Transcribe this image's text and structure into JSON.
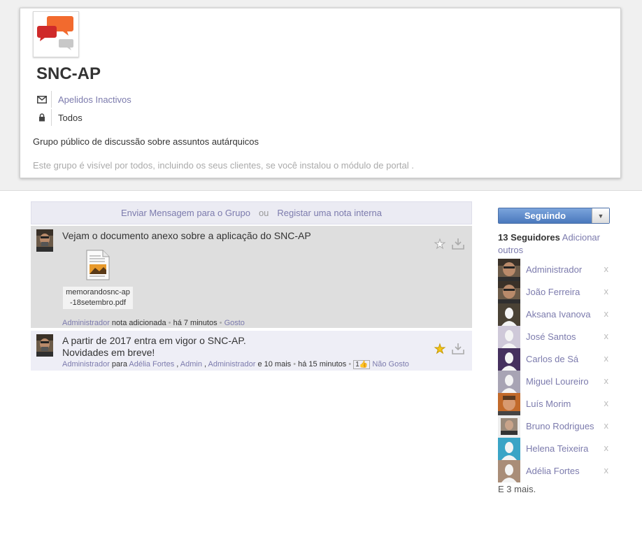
{
  "group": {
    "title": "SNC-AP",
    "email_link": "Apelidos Inactivos",
    "privacy": "Todos",
    "description": "Grupo público de discussão sobre assuntos autárquicos",
    "visibility_note": "Este grupo é visível por todos, incluindo os seus clientes, se você instalou o módulo de portal ."
  },
  "compose": {
    "send_label": "Enviar Mensagem para o Grupo",
    "or_label": "ou",
    "note_label": "Registar uma nota interna"
  },
  "messages": [
    {
      "body": "Vejam o documento anexo sobre a aplicação do SNC-AP",
      "attachment_line1": "memorandosnc-ap",
      "attachment_line2": "-18setembro.pdf",
      "author": "Administrador",
      "action": "nota adicionada",
      "time": "há 7 minutos",
      "like_label": "Gosto",
      "starred": false
    },
    {
      "body_line1": "A partir de 2017 entra em vigor o SNC-AP.",
      "body_line2": "Novidades em breve!",
      "author": "Administrador",
      "to_label": "para",
      "recipient1": "Adélia Fortes",
      "recipient2": "Admin",
      "recipient3": "Administrador",
      "others": "e 10 mais",
      "time": "há 15 minutos",
      "like_count": "1",
      "unlike_label": "Não Gosto",
      "starred": true
    }
  ],
  "followers": {
    "button_label": "Seguindo",
    "count_label": "13 Seguidores",
    "add_label": "Adicionar outros",
    "remove_symbol": "x",
    "items": [
      {
        "name": "Administrador",
        "avatar": "photo-man"
      },
      {
        "name": "João Ferreira",
        "avatar": "photo-man"
      },
      {
        "name": "Aksana Ivanova",
        "avatar": "placeholder-dark"
      },
      {
        "name": "José Santos",
        "avatar": "placeholder-light"
      },
      {
        "name": "Carlos de Sá",
        "avatar": "placeholder-purple"
      },
      {
        "name": "Miguel Loureiro",
        "avatar": "placeholder-grey"
      },
      {
        "name": "Luís Morim",
        "avatar": "photo-man-orange"
      },
      {
        "name": "Bruno Rodrigues",
        "avatar": "photo-man-small"
      },
      {
        "name": "Helena Teixeira",
        "avatar": "placeholder-blue"
      },
      {
        "name": "Adélia Fortes",
        "avatar": "placeholder-tan"
      }
    ],
    "more_label": "E 3 mais."
  },
  "colors": {
    "link": "#7c7bad",
    "button": "#4a79bd",
    "star_active": "#f5c518"
  }
}
